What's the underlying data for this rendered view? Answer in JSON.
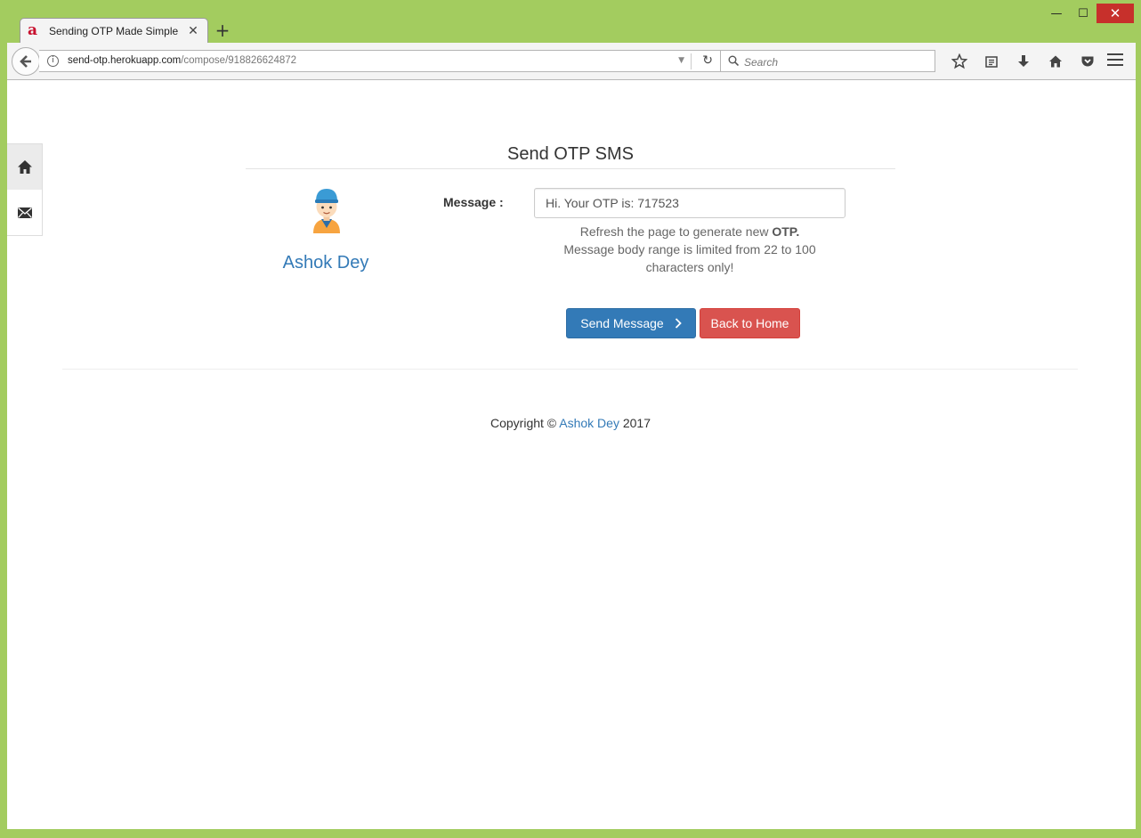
{
  "browser": {
    "tab_title": "Sending OTP Made Simple",
    "tab_close": "✕",
    "new_tab": "+",
    "url_host": "send-otp.herokuapp.com",
    "url_path": "/compose/918826624872",
    "search_placeholder": "Search",
    "window": {
      "minimize": "—",
      "maximize": "☐",
      "close": "✕"
    }
  },
  "page": {
    "heading": "Send OTP SMS",
    "user_name": "Ashok Dey",
    "message_label": "Message :",
    "message_value": "Hi. Your OTP is: 717523",
    "help_line1_prefix": "Refresh the page to generate new ",
    "help_line1_bold": "OTP.",
    "help_line2": "Message body range is limited from 22 to 100 characters only!",
    "send_button": "Send Message",
    "home_button": "Back to Home",
    "footer_prefix": "Copyright © ",
    "footer_link": "Ashok Dey",
    "footer_suffix": " 2017"
  },
  "colors": {
    "frame": "#a3cc5f",
    "primary": "#337ab7",
    "danger": "#d9534f"
  }
}
